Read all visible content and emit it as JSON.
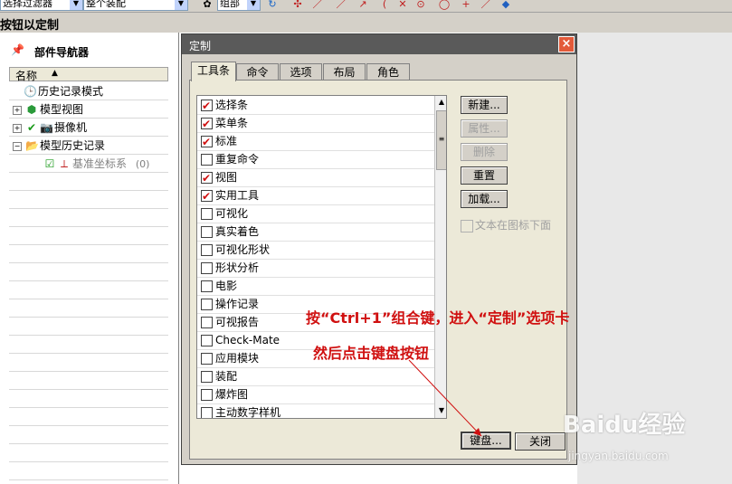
{
  "toolbar": {
    "combo1": "选择过滤器",
    "combo2": "整个装配",
    "combo3": "组部",
    "icons": [
      "snap-icon",
      "refresh-icon",
      "point-icon",
      "line-icon",
      "arc-icon",
      "circle-icon",
      "plus-icon",
      "view-icon"
    ]
  },
  "titlebar": {
    "label": "按钮以定制"
  },
  "navigator": {
    "title": "部件导航器",
    "column_name": "名称",
    "items": [
      {
        "label": "历史记录模式",
        "icon": "clock-icon",
        "indent": 1,
        "expander": ""
      },
      {
        "label": "模型视图",
        "icon": "cube-icon",
        "indent": 0,
        "expander": "+"
      },
      {
        "label": "摄像机",
        "icon": "camera-icon",
        "indent": 0,
        "expander": "+"
      },
      {
        "label": "模型历史记录",
        "icon": "folder-icon",
        "indent": 0,
        "expander": "−"
      },
      {
        "label": "基准坐标系",
        "suffix": "(0)",
        "icon": "csys-icon",
        "indent": 2,
        "expander": ""
      }
    ]
  },
  "dialog": {
    "title": "定制",
    "close_label": "×",
    "tabs": [
      "工具条",
      "命令",
      "选项",
      "布局",
      "角色"
    ],
    "active_tab": 0,
    "toolbars": [
      {
        "label": "选择条",
        "checked": true
      },
      {
        "label": "菜单条",
        "checked": true
      },
      {
        "label": "标准",
        "checked": true
      },
      {
        "label": "重复命令",
        "checked": false
      },
      {
        "label": "视图",
        "checked": true
      },
      {
        "label": "实用工具",
        "checked": true
      },
      {
        "label": "可视化",
        "checked": false
      },
      {
        "label": "真实着色",
        "checked": false
      },
      {
        "label": "可视化形状",
        "checked": false
      },
      {
        "label": "形状分析",
        "checked": false
      },
      {
        "label": "电影",
        "checked": false
      },
      {
        "label": "操作记录",
        "checked": false
      },
      {
        "label": "可视报告",
        "checked": false
      },
      {
        "label": "Check-Mate",
        "checked": false
      },
      {
        "label": "应用模块",
        "checked": false
      },
      {
        "label": "装配",
        "checked": false
      },
      {
        "label": "爆炸图",
        "checked": false
      },
      {
        "label": "主动数字样机",
        "checked": false
      }
    ],
    "buttons": {
      "new": "新建...",
      "properties": "属性...",
      "delete": "删除",
      "reset": "重置",
      "load": "加载..."
    },
    "text_below_icon": "文本在图标下面",
    "keyboard": "键盘...",
    "close": "关闭"
  },
  "annotations": {
    "line1": "按“Ctrl+1”组合键，进入“定制”选项卡",
    "line2": "然后点击键盘按钮"
  },
  "watermark": {
    "brand": "Baidu经验",
    "url": "jingyan.baidu.com"
  },
  "colors": {
    "annotation": "#d01010",
    "dialog_title": "#5a5a5a",
    "close_button": "#e35a3a"
  }
}
